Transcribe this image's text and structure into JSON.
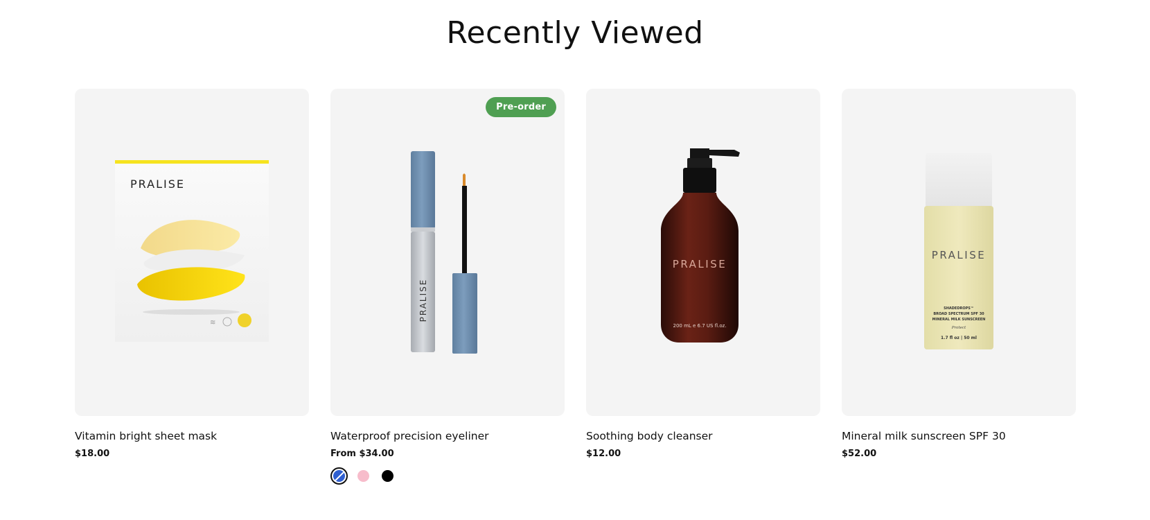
{
  "section": {
    "title": "Recently Viewed"
  },
  "products": [
    {
      "title": "Vitamin bright sheet mask",
      "price": "$18.00",
      "image_brand": "PRALISE"
    },
    {
      "title": "Waterproof precision eyeliner",
      "price": "From $34.00",
      "badge": "Pre-order",
      "badge_color": "#4f9f52",
      "image_brand": "PRALISE",
      "swatches": [
        {
          "name": "blue",
          "color": "#2f5fd0",
          "selected": true
        },
        {
          "name": "pink",
          "color": "#f7bccb",
          "selected": false
        },
        {
          "name": "black",
          "color": "#000000",
          "selected": false
        }
      ]
    },
    {
      "title": "Soothing body cleanser",
      "price": "$12.00",
      "image_brand": "PRALISE",
      "image_volume": "200 mL e 6.7 US fl.oz."
    },
    {
      "title": "Mineral milk sunscreen SPF 30",
      "price": "$52.00",
      "image_brand": "PRALISE",
      "image_lines": [
        "SHADEDROPS™",
        "BROAD SPECTRUM SPF 30",
        "MINERAL MILK SUNSCREEN",
        "Protect",
        "1.7 fl oz | 50 ml"
      ]
    }
  ],
  "colors": {
    "card_bg": "#f4f4f4",
    "text": "#111111"
  }
}
